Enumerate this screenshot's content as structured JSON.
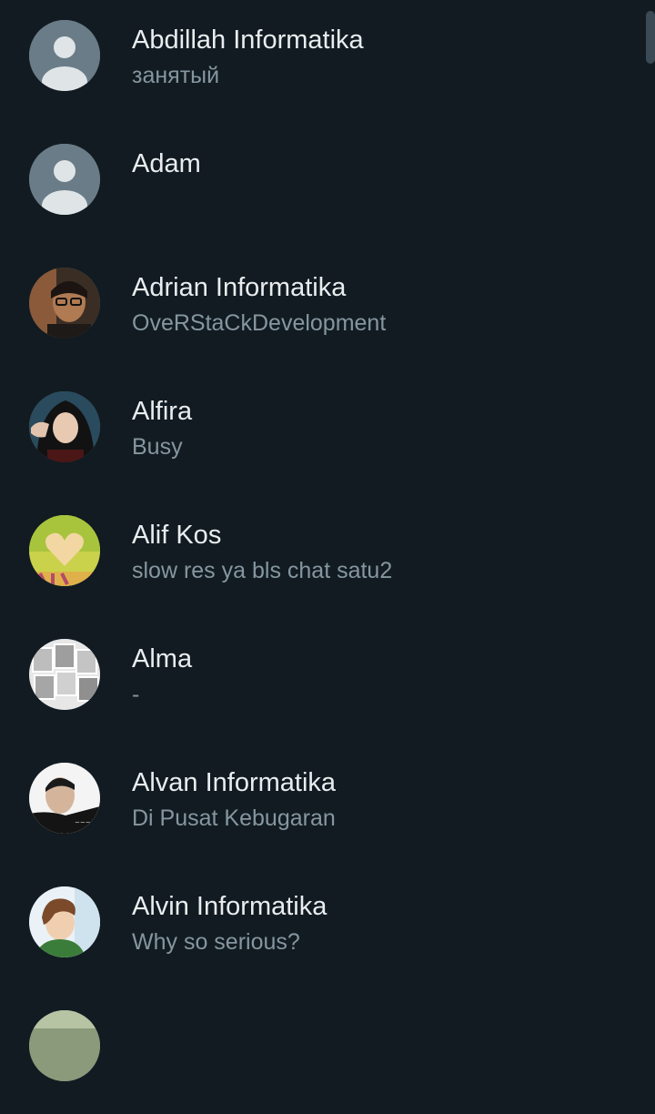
{
  "contacts": [
    {
      "name": "Abdillah Informatika",
      "status": "занятый",
      "avatar": "default-avatar-icon"
    },
    {
      "name": "Adam",
      "status": "",
      "avatar": "default-avatar-icon"
    },
    {
      "name": "Adrian Informatika",
      "status": "OveRStaCkDevelopment",
      "avatar": "photo-avatar"
    },
    {
      "name": "Alfira",
      "status": "Busy",
      "avatar": "photo-avatar"
    },
    {
      "name": "Alif Kos",
      "status": "slow res ya bls chat satu2",
      "avatar": "photo-avatar"
    },
    {
      "name": "Alma",
      "status": "-",
      "avatar": "photo-avatar"
    },
    {
      "name": "Alvan Informatika",
      "status": "Di Pusat Kebugaran",
      "avatar": "photo-avatar"
    },
    {
      "name": "Alvin Informatika",
      "status": "Why so serious?",
      "avatar": "photo-avatar"
    }
  ],
  "colors": {
    "background": "#111b21",
    "name_text": "#e9edef",
    "status_text": "#8696a0",
    "default_avatar_bg": "#6a7c88"
  }
}
